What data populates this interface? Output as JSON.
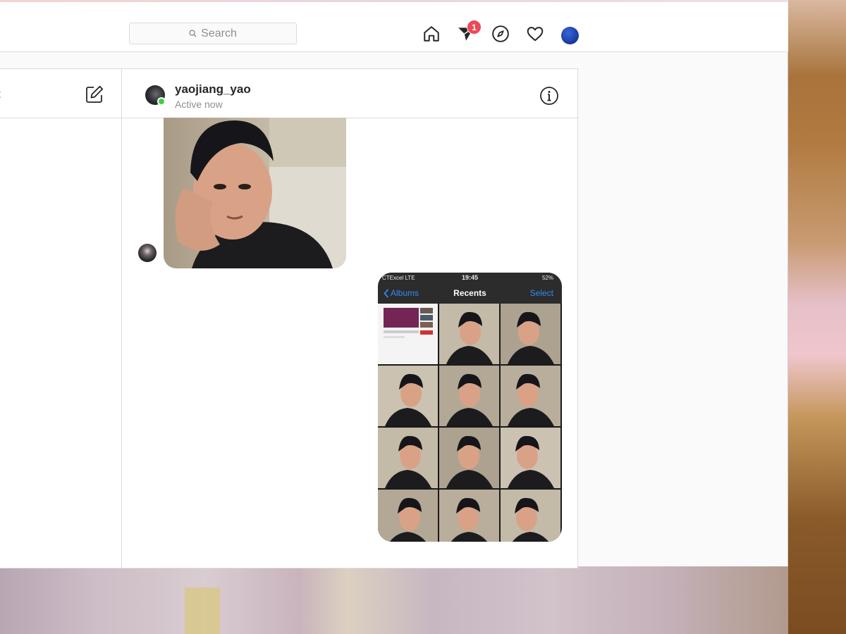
{
  "search": {
    "placeholder": "Search"
  },
  "nav": {
    "icons": [
      "home-icon",
      "direct-icon",
      "explore-icon",
      "activity-icon",
      "profile-avatar"
    ],
    "direct_badge": "1"
  },
  "direct": {
    "left_title_fragment": "t",
    "thread": {
      "username": "yaojiang_yao",
      "status": "Active now"
    }
  },
  "phone_screenshot": {
    "carrier": "CTExcel  LTE",
    "time": "19:45",
    "battery": "52%",
    "back_label": "Albums",
    "title": "Recents",
    "select_label": "Select"
  },
  "colors": {
    "badge": "#ed4956",
    "online": "#3ecf3e",
    "ios_blue": "#2f8cf5",
    "profile": "#1c3fa6"
  }
}
